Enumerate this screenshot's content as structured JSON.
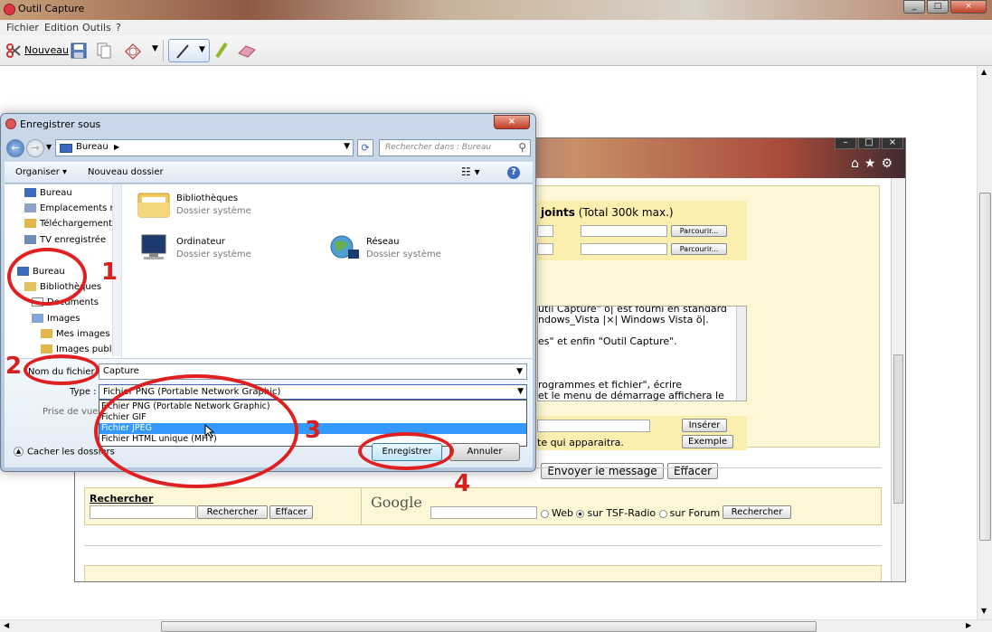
{
  "window": {
    "title": "Outil Capture",
    "controls": [
      "_",
      "□",
      "×"
    ],
    "menu": [
      "Fichier",
      "Edition",
      "Outils",
      "?"
    ],
    "toolbar": {
      "new_label": "Nouveau"
    }
  },
  "webpage": {
    "pieces_jointes": {
      "title": "joints",
      "limit": "(Total 300k max.)",
      "browse_label": "Parcourir..."
    },
    "message_lines": [
      "util Capture\" ó| est fourni en standard",
      "ndows_Vista |×| Windows Vista  ö|.",
      "es\" et enfin \"Outil Capture\".",
      "rogrammes et fichier\", écrire",
      "et le menu de démarrage affichera le"
    ],
    "insert_button": "Insérer",
    "example_button": "Exemple",
    "insert_hint": "te qui apparaitra.",
    "send_button": "Envoyer le message",
    "clear_button": "Effacer",
    "search": {
      "title": "Rechercher",
      "search_button": "Rechercher",
      "clear_button": "Effacer",
      "google": "Google",
      "radio_web": "Web",
      "radio_tsf": "sur TSF-Radio",
      "radio_forum": "sur Forum",
      "google_button": "Rechercher"
    }
  },
  "dialog": {
    "title": "Enregistrer sous",
    "close": "×",
    "address": "Bureau",
    "search_placeholder": "Rechercher dans : Bureau",
    "organize": "Organiser ▾",
    "new_folder": "Nouveau dossier",
    "nav_items": [
      "Bureau",
      "Emplacements ré",
      "Téléchargements",
      "TV enregistrée",
      "Bureau",
      "Bibliothèques",
      "Documents",
      "Images",
      "Mes images",
      "Images publi"
    ],
    "files": [
      {
        "name": "Bibliothèques",
        "desc": "Dossier système"
      },
      {
        "name": "Ordinateur",
        "desc": "Dossier système"
      },
      {
        "name": "Réseau",
        "desc": "Dossier système"
      }
    ],
    "filename_label": "Nom du fichier :",
    "filename_value": "Capture",
    "type_label": "Type :",
    "type_value": "Fichier PNG (Portable Network Graphic)",
    "type_options": [
      "Fichier PNG (Portable Network Graphic)",
      "Fichier GIF",
      "Fichier JPEG",
      "Fichier HTML unique (MHT)"
    ],
    "selected_option_index": 2,
    "preview_label": "Prise de vue :",
    "hide_folders": "Cacher les dossiers",
    "save_button": "Enregistrer",
    "cancel_button": "Annuler"
  },
  "annotations": [
    "1",
    "2",
    "3",
    "4"
  ],
  "colors": {
    "annotation": "#e02020",
    "highlight": "#3399ff",
    "cream": "#fdf7d6"
  }
}
